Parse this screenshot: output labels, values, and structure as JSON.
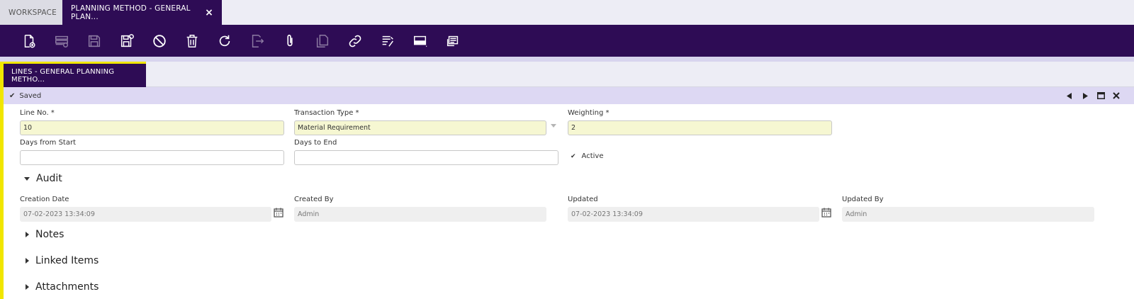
{
  "tabs": {
    "workspace": "WORKSPACE",
    "active": "PLANNING METHOD - GENERAL PLAN...",
    "close": "×"
  },
  "toolbar": {
    "buttons": [
      {
        "name": "new-document-icon",
        "disabled": false
      },
      {
        "name": "new-row-icon",
        "disabled": true
      },
      {
        "name": "save-icon",
        "disabled": true
      },
      {
        "name": "save-and-close-icon",
        "disabled": false
      },
      {
        "name": "undo-cancel-icon",
        "disabled": false
      },
      {
        "name": "delete-icon",
        "disabled": false
      },
      {
        "name": "refresh-icon",
        "disabled": false
      },
      {
        "name": "export-icon",
        "disabled": true
      },
      {
        "name": "attachment-icon",
        "disabled": false
      },
      {
        "name": "copy-record-icon",
        "disabled": true
      },
      {
        "name": "link-icon",
        "disabled": false
      },
      {
        "name": "audit-trail-icon",
        "disabled": false
      },
      {
        "name": "grid-view-icon",
        "disabled": false
      },
      {
        "name": "notes-icon",
        "disabled": false
      }
    ]
  },
  "subtab": {
    "label": "LINES - GENERAL PLANNING METHO..."
  },
  "status": {
    "text": "Saved"
  },
  "form": {
    "line_no": {
      "label": "Line No. *",
      "value": "10"
    },
    "transaction_type": {
      "label": "Transaction Type *",
      "value": "Material Requirement"
    },
    "weighting": {
      "label": "Weighting *",
      "value": "2"
    },
    "days_from_start": {
      "label": "Days from Start",
      "value": ""
    },
    "days_to_end": {
      "label": "Days to End",
      "value": ""
    },
    "active": {
      "label": "Active",
      "checked": true
    }
  },
  "sections": {
    "audit": "Audit",
    "notes": "Notes",
    "linked_items": "Linked Items",
    "attachments": "Attachments"
  },
  "audit": {
    "creation_date": {
      "label": "Creation Date",
      "value": "07-02-2023 13:34:09"
    },
    "created_by": {
      "label": "Created By",
      "value": "Admin"
    },
    "updated": {
      "label": "Updated",
      "value": "07-02-2023 13:34:09"
    },
    "updated_by": {
      "label": "Updated By",
      "value": "Admin"
    }
  },
  "colors": {
    "brand": "#2e0c55",
    "accent": "#f1e600",
    "status_bg": "#ddd8f3",
    "required_bg": "#f6f7d2"
  }
}
